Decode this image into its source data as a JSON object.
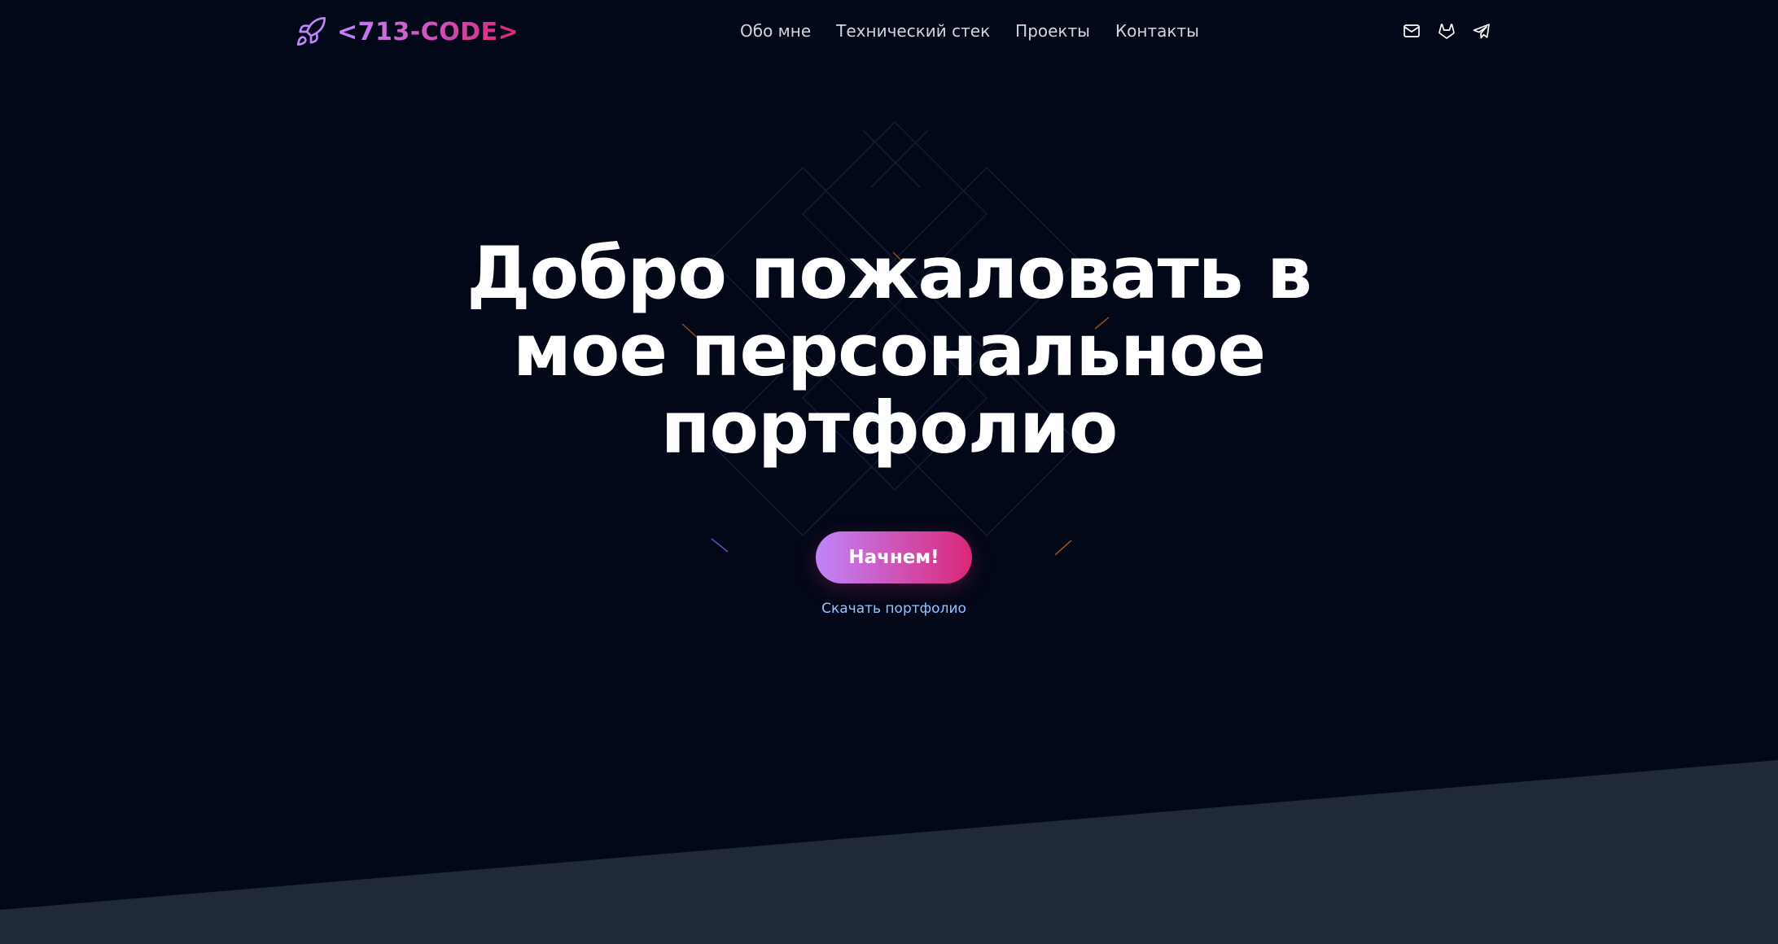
{
  "header": {
    "logo_text": "<713-CODE>",
    "logo_icon": "rocket-icon",
    "nav": [
      {
        "label": "Обо мне"
      },
      {
        "label": "Технический стек"
      },
      {
        "label": "Проекты"
      },
      {
        "label": "Контакты"
      }
    ],
    "socials": [
      {
        "icon": "mail-icon"
      },
      {
        "icon": "gitlab-icon"
      },
      {
        "icon": "telegram-icon"
      }
    ]
  },
  "hero": {
    "title": "Добро пожаловать в мое персональное портфолио",
    "cta_label": "Начнем!",
    "download_label": "Скачать портфолио"
  },
  "colors": {
    "background": "#030818",
    "bottom_band": "#1f2937",
    "accent_start": "#c084fc",
    "accent_end": "#db2777",
    "link": "#93c5fd",
    "nav_text": "#d1d5db"
  }
}
